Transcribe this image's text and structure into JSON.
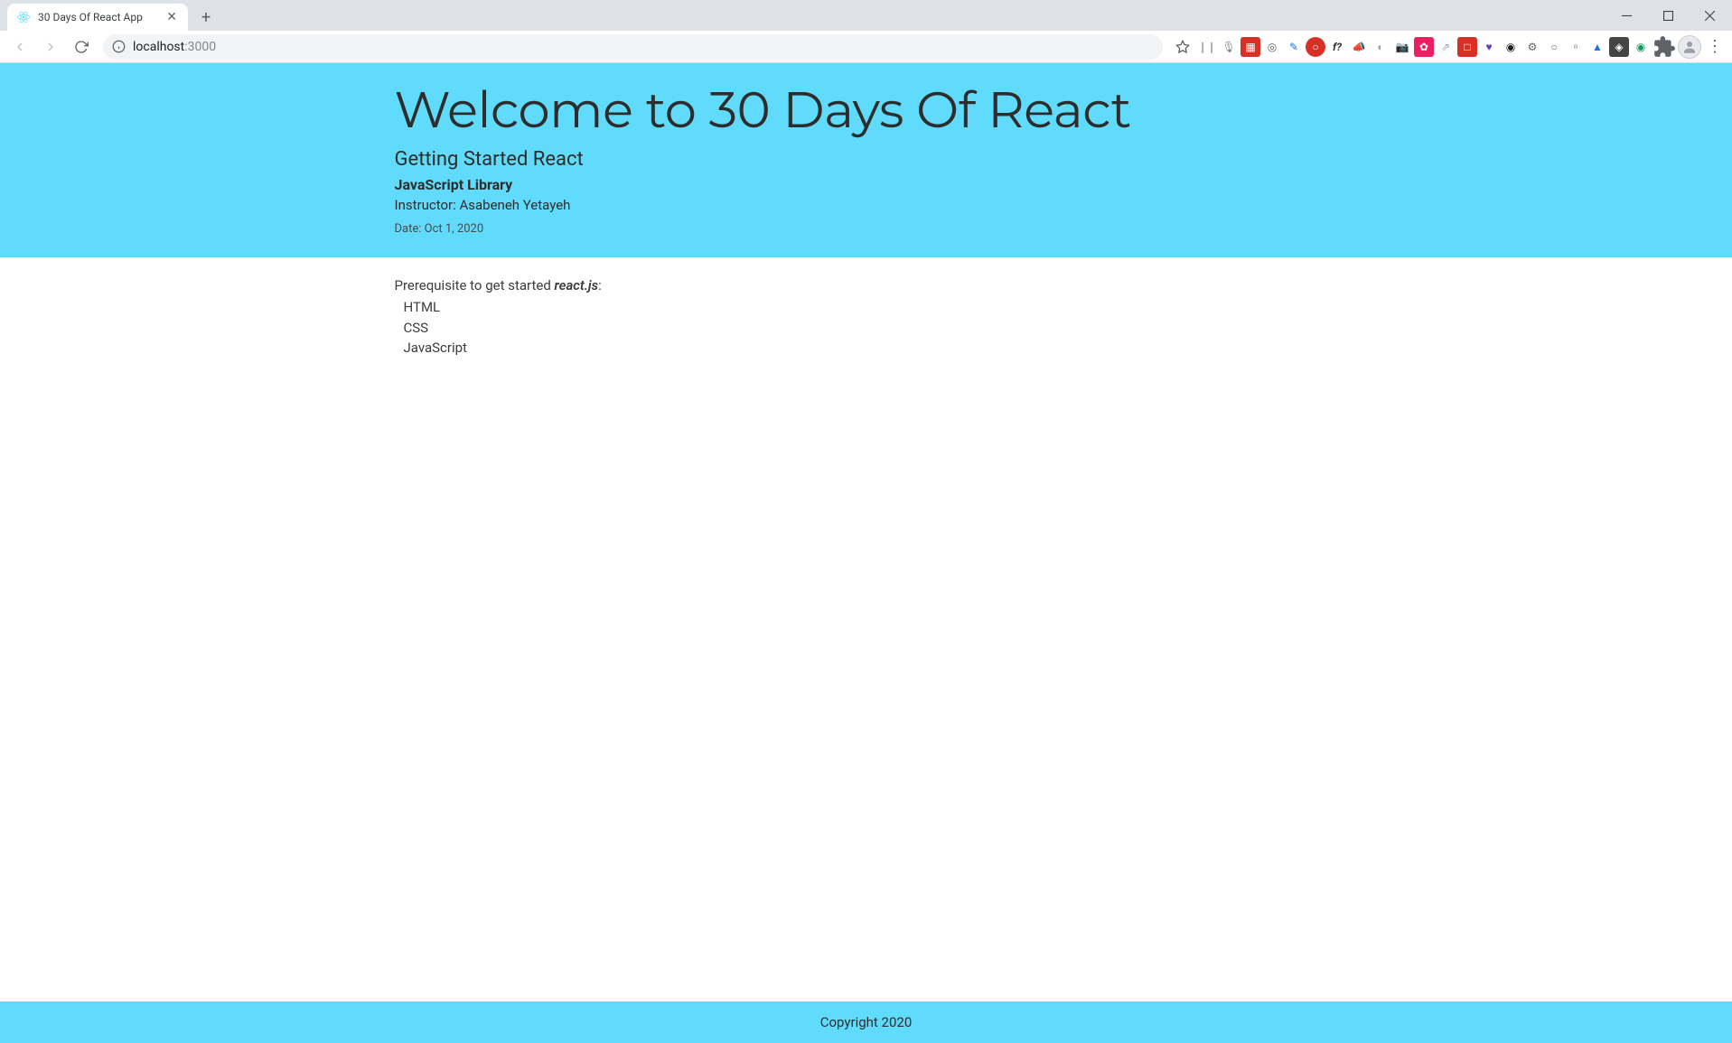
{
  "browser": {
    "tab": {
      "title": "30 Days Of React App"
    },
    "url": {
      "host": "localhost",
      "port": ":3000"
    }
  },
  "header": {
    "title": "Welcome to 30 Days Of React",
    "subtitle": "Getting Started React",
    "library": "JavaScript Library",
    "instructor": "Instructor: Asabeneh Yetayeh",
    "date": "Date: Oct 1, 2020"
  },
  "main": {
    "prereq_prefix": "Prerequisite to get started ",
    "prereq_em": "react.js",
    "prereq_suffix": ":",
    "items": [
      "HTML",
      "CSS",
      "JavaScript"
    ]
  },
  "footer": {
    "copyright": "Copyright 2020"
  },
  "colors": {
    "accent": "#61dbfb"
  }
}
